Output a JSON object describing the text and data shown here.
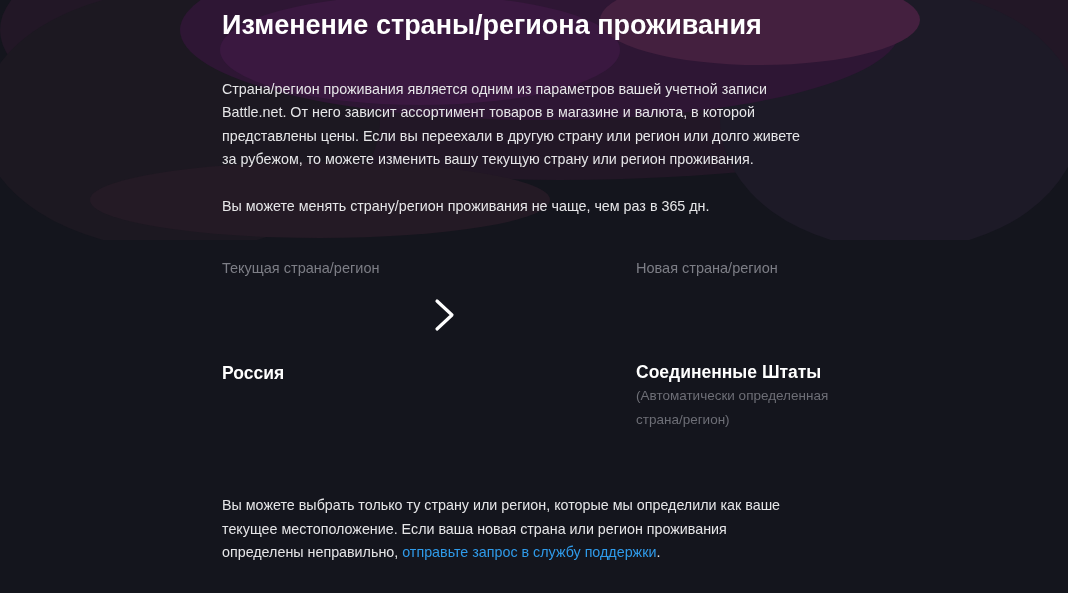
{
  "title": "Изменение страны/региона проживания",
  "intro": "Страна/регион проживания является одним из параметров вашей учетной записи Battle.net. От него зависит ассортимент товаров в магазине и валюта, в которой представлены цены. Если вы переехали в другую страну или регион или долго живете за рубежом, то можете изменить вашу текущую страну или регион проживания.",
  "limit_note": "Вы можете менять страну/регион проживания не чаще, чем раз в 365 дн.",
  "current": {
    "label": "Текущая страна/регион",
    "country": "Россия"
  },
  "new": {
    "label": "Новая страна/регион",
    "country": "Соединенные Штаты",
    "note": "(Автоматически определенная страна/регион)"
  },
  "bottom_note": {
    "text": "Вы можете выбрать только ту страну или регион, которые мы определили как ваше текущее местоположение. Если ваша новая страна или регион проживания определены неправильно, ",
    "link": "отправьте запрос в службу поддержки",
    "after": "."
  }
}
